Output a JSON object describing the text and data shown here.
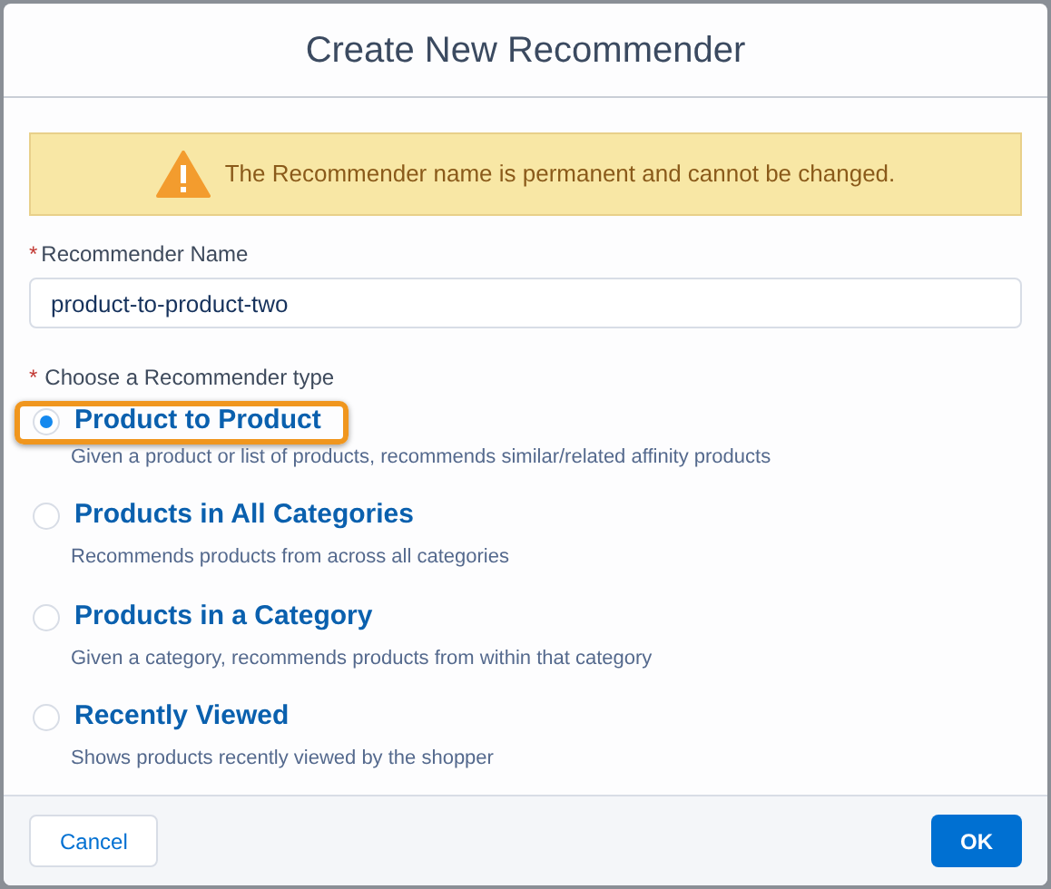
{
  "dialog": {
    "title": "Create New Recommender"
  },
  "warning": {
    "text": "The Recommender name is permanent and cannot be changed."
  },
  "name_field": {
    "required_mark": "*",
    "label": "Recommender Name",
    "value": "product-to-product-two"
  },
  "type_group": {
    "required_mark": "*",
    "label": "Choose a Recommender type",
    "options": [
      {
        "title": "Product to Product",
        "description": "Given a product or list of products, recommends similar/related affinity products",
        "selected": true,
        "highlighted": true
      },
      {
        "title": "Products in All Categories",
        "description": "Recommends products from across all categories",
        "selected": false,
        "highlighted": false
      },
      {
        "title": "Products in a Category",
        "description": "Given a category, recommends products from within that category",
        "selected": false,
        "highlighted": false
      },
      {
        "title": "Recently Viewed",
        "description": "Shows products recently viewed by the shopper",
        "selected": false,
        "highlighted": false
      }
    ]
  },
  "footer": {
    "cancel": "Cancel",
    "ok": "OK"
  }
}
